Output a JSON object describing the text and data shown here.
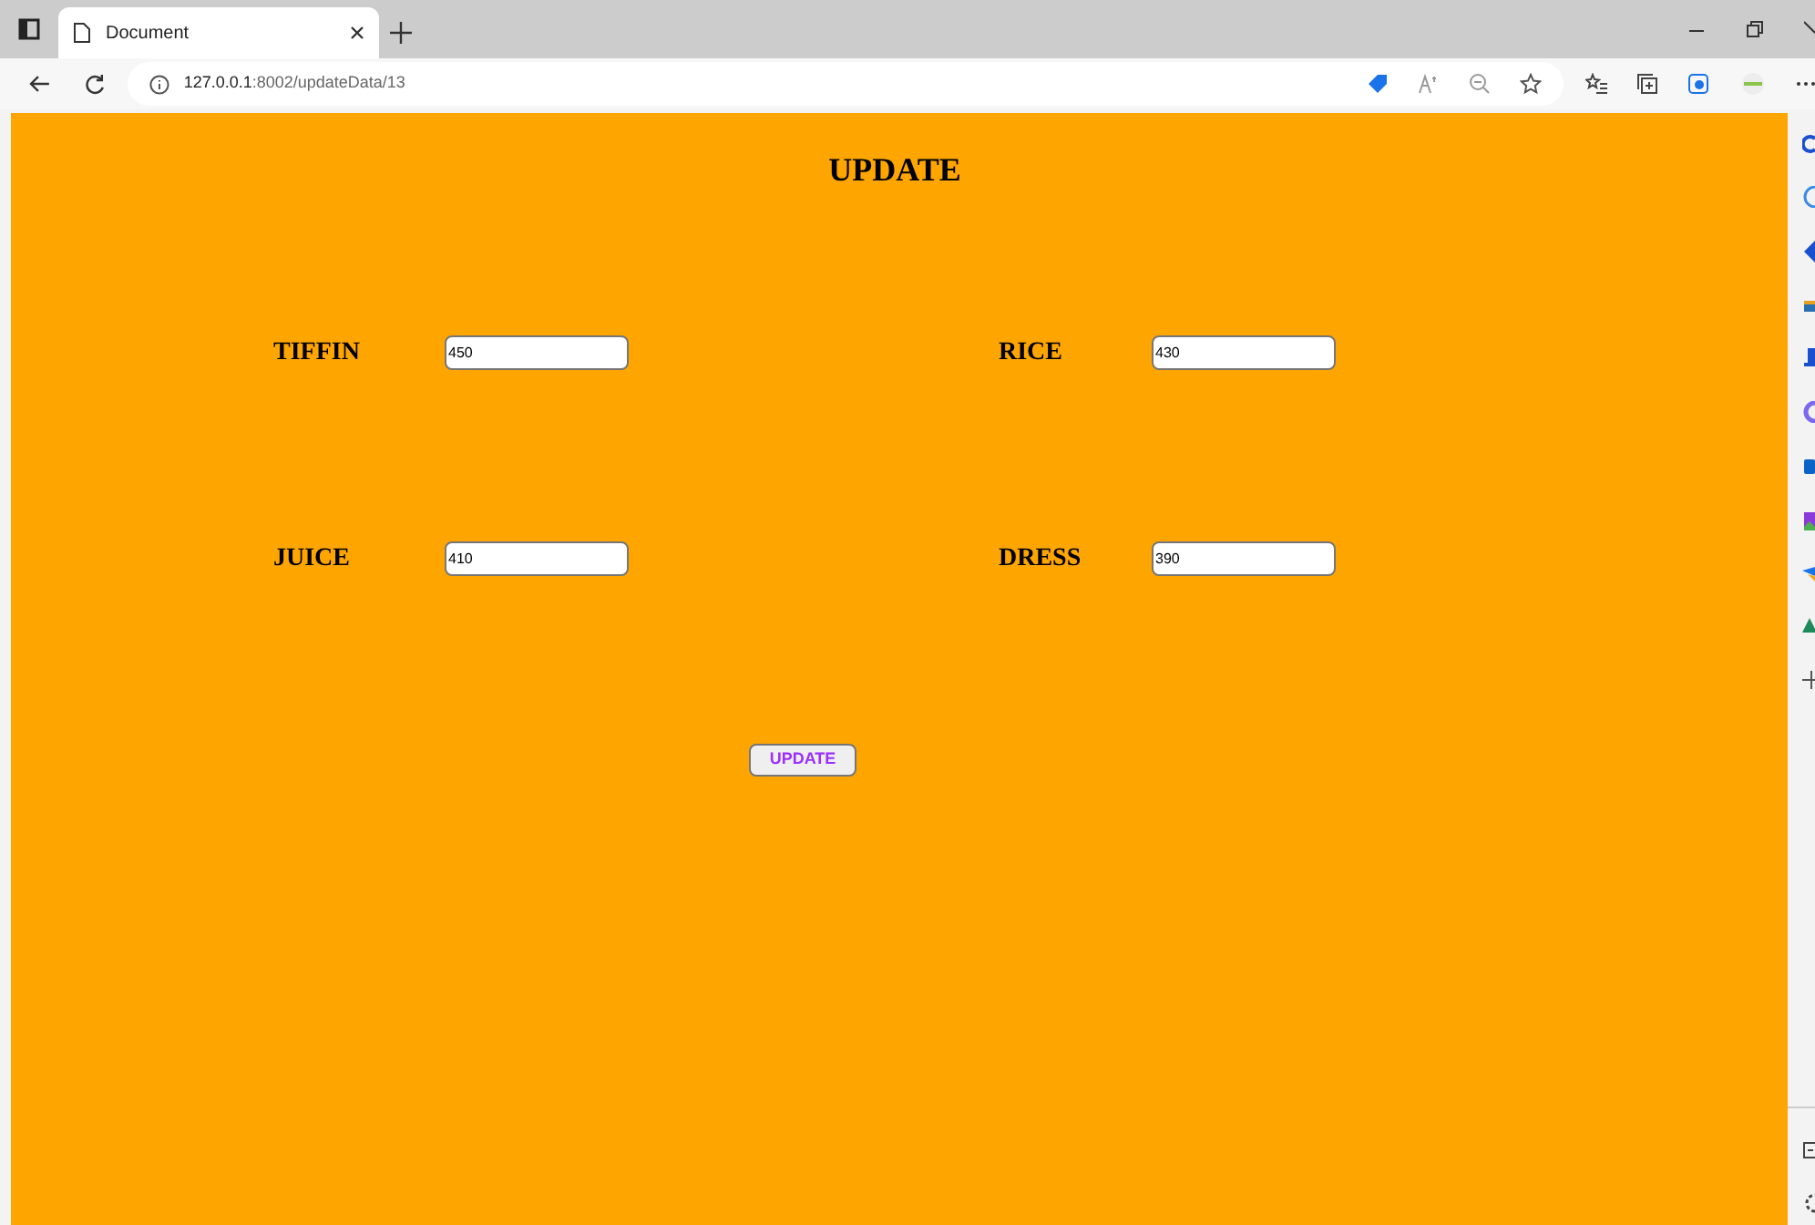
{
  "browser": {
    "tab_title": "Document",
    "url_host": "127.0.0.1",
    "url_path": ":8002/updateData/13"
  },
  "page": {
    "heading": "UPDATE",
    "fields": [
      {
        "label": "TIFFIN",
        "value": "450"
      },
      {
        "label": "RICE",
        "value": "430"
      },
      {
        "label": "JUICE",
        "value": "410"
      },
      {
        "label": "DRESS",
        "value": "390"
      }
    ],
    "button": "UPDATE"
  }
}
